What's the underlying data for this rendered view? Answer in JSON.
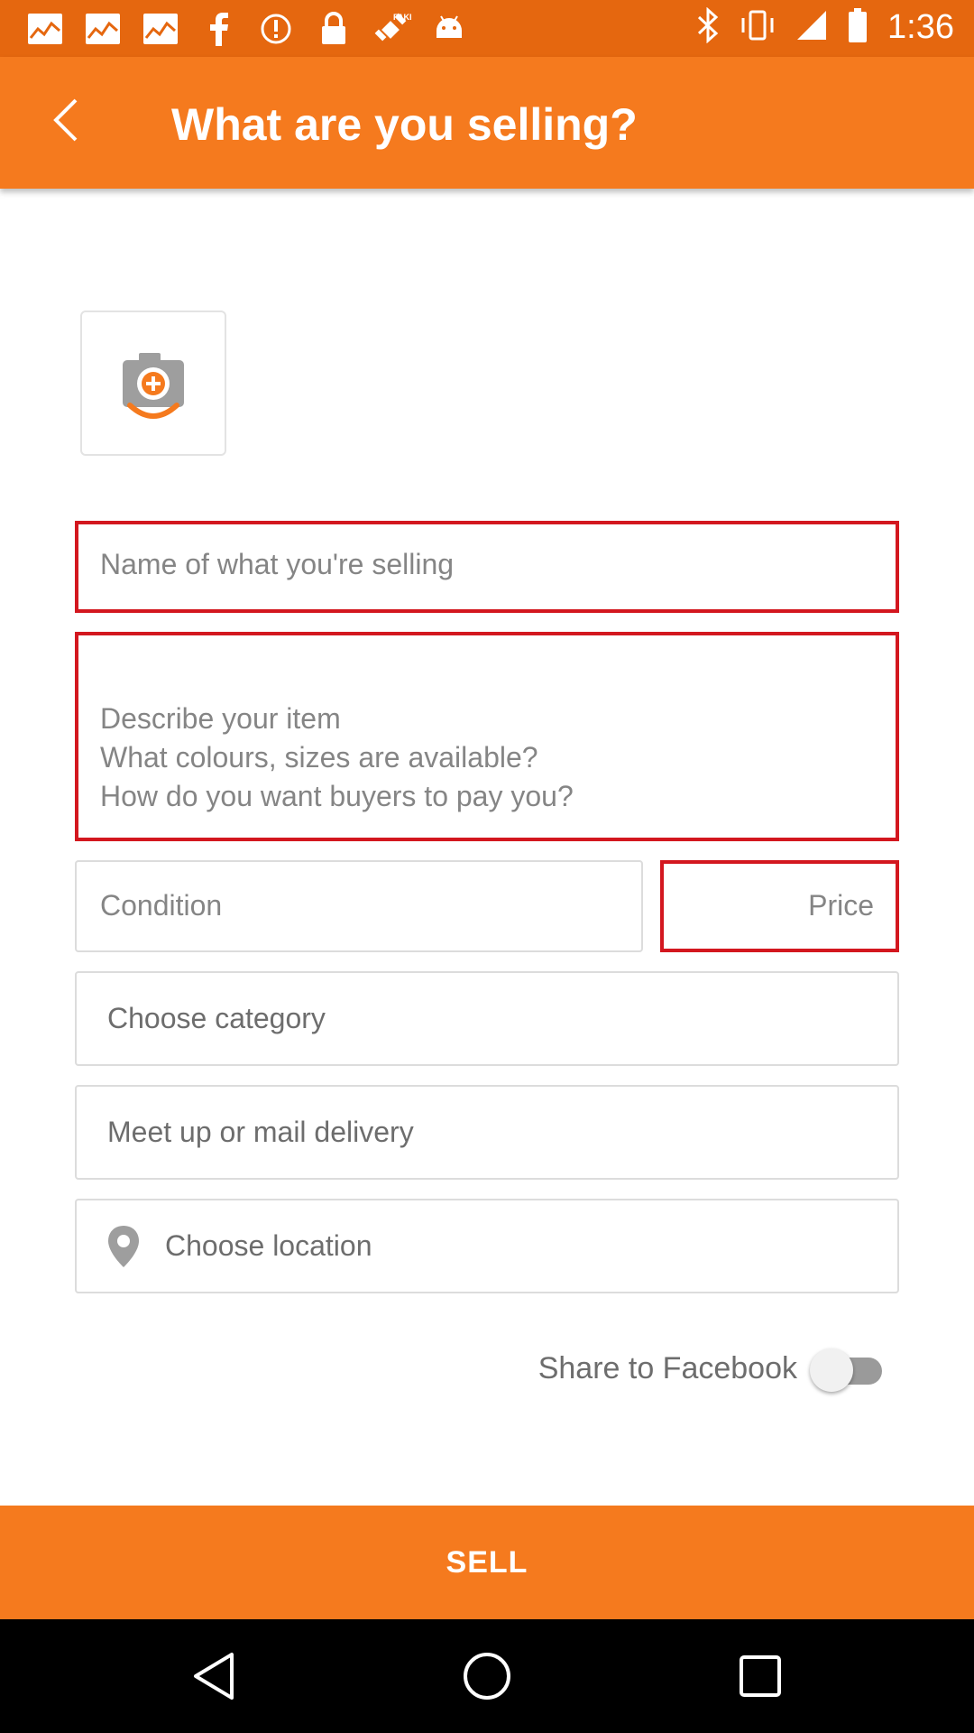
{
  "status_bar": {
    "time": "1:36",
    "left_icons": [
      "iifl-markets-icon",
      "iifl-markets-icon",
      "iifl-markets-icon",
      "facebook-icon",
      "alert-icon",
      "lock-icon",
      "fake-gps-icon",
      "android-icon"
    ],
    "right_icons": [
      "bluetooth-icon",
      "vibrate-icon",
      "signal-icon",
      "battery-icon"
    ]
  },
  "header": {
    "title": "What are you selling?"
  },
  "form": {
    "name_placeholder": "Name of what you're selling",
    "description_placeholder": "Describe your item\nWhat colours, sizes are available?\nHow do you want buyers to pay you?",
    "condition_placeholder": "Condition",
    "price_placeholder": "Price",
    "category_label": "Choose category",
    "delivery_label": "Meet up or mail delivery",
    "location_label": "Choose location",
    "share_label": "Share to Facebook",
    "share_enabled": false
  },
  "footer": {
    "sell_label": "SELL"
  },
  "colors": {
    "accent": "#f57a1e",
    "status_bar": "#e5670f",
    "error_border": "#d3171f"
  }
}
